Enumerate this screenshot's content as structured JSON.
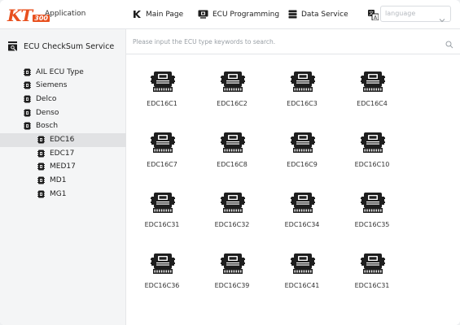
{
  "app": {
    "logo_text": "KT",
    "logo_number": "300",
    "name": "Application"
  },
  "nav": {
    "main_page": "Main Page",
    "ecu_programming": "ECU Programming",
    "data_service": "Data Service"
  },
  "language": {
    "placeholder": "language"
  },
  "sidebar": {
    "title": "ECU CheckSum Service",
    "items": [
      {
        "label": "AIL ECU Type",
        "level": 0
      },
      {
        "label": "Siemens",
        "level": 0
      },
      {
        "label": "Delco",
        "level": 0
      },
      {
        "label": "Denso",
        "level": 0
      },
      {
        "label": "Bosch",
        "level": 0
      },
      {
        "label": "EDC16",
        "level": 1,
        "selected": true
      },
      {
        "label": "EDC17",
        "level": 1
      },
      {
        "label": "MED17",
        "level": 1
      },
      {
        "label": "MD1",
        "level": 1
      },
      {
        "label": "MG1",
        "level": 1
      }
    ]
  },
  "search": {
    "placeholder": "Please input the ECU type keywords to search."
  },
  "ecus": [
    "EDC16C1",
    "EDC16C2",
    "EDC16C3",
    "EDC16C4",
    "EDC16C7",
    "EDC16C8",
    "EDC16C9",
    "EDC16C10",
    "EDC16C31",
    "EDC16C32",
    "EDC16C34",
    "EDC16C35",
    "EDC16C36",
    "EDC16C39",
    "EDC16C41",
    "EDC16C31"
  ],
  "icons": {
    "main_page": "k-logo-icon",
    "ecu_programming": "chip-monitor-icon",
    "data_service": "database-icon",
    "language": "translate-icon",
    "search": "search-icon",
    "ecu_card": "ecu-module-icon",
    "tree_item": "ecu-chip-icon"
  },
  "colors": {
    "brand": "#e8501e",
    "icon_dark": "#1e1e1e",
    "selected_row": "#e1e2e4"
  }
}
